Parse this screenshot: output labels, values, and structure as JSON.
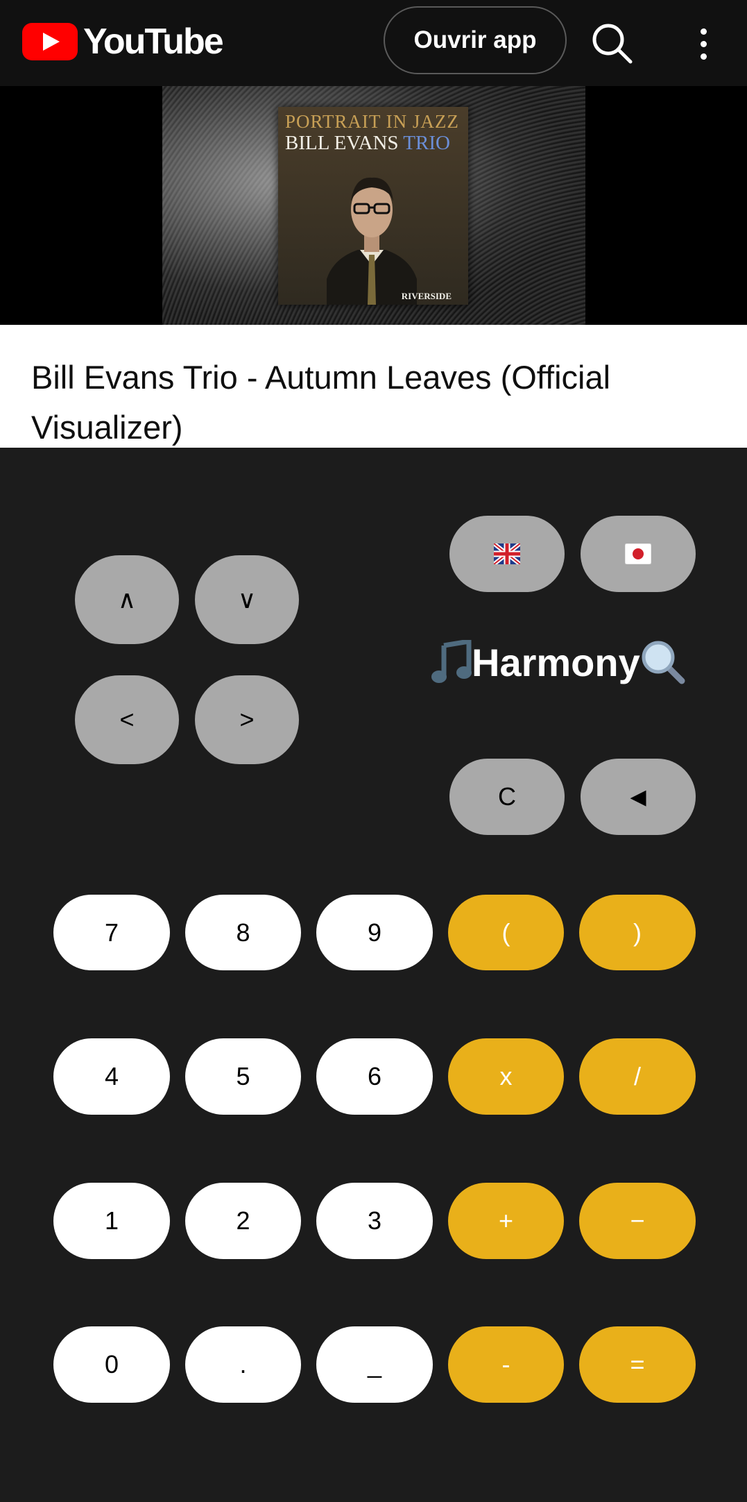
{
  "header": {
    "logo_text": "YouTube",
    "open_app_label": "Ouvrir app",
    "search_icon": "search-icon",
    "more_icon": "more-vert-icon"
  },
  "video": {
    "cover_line1": "PORTRAIT IN JAZZ",
    "cover_line2_a": "BILL EVANS ",
    "cover_line2_b": "TRIO",
    "cover_label": "RIVERSIDE"
  },
  "title": "Bill Evans Trio - Autumn Leaves (Official Visualizer)",
  "calculator": {
    "nav": {
      "up": "∧",
      "down": "∨",
      "left": "<",
      "right": ">"
    },
    "lang": {
      "en_icon": "uk-flag-icon",
      "ja_icon": "japan-flag-icon"
    },
    "app_name": "Harmony",
    "app_name_icons": [
      "musical-note-icon",
      "magnifier-icon"
    ],
    "clear": "C",
    "backspace": "◀",
    "keys": [
      [
        "7",
        "8",
        "9",
        "(",
        ")"
      ],
      [
        "4",
        "5",
        "6",
        "x",
        "/"
      ],
      [
        "1",
        "2",
        "3",
        "+",
        "−"
      ],
      [
        "0",
        ".",
        "_",
        "-",
        "="
      ]
    ],
    "colors": {
      "grey": "#a9a9a9",
      "white": "#ffffff",
      "orange": "#e9b01a",
      "background": "#1c1c1c"
    }
  }
}
